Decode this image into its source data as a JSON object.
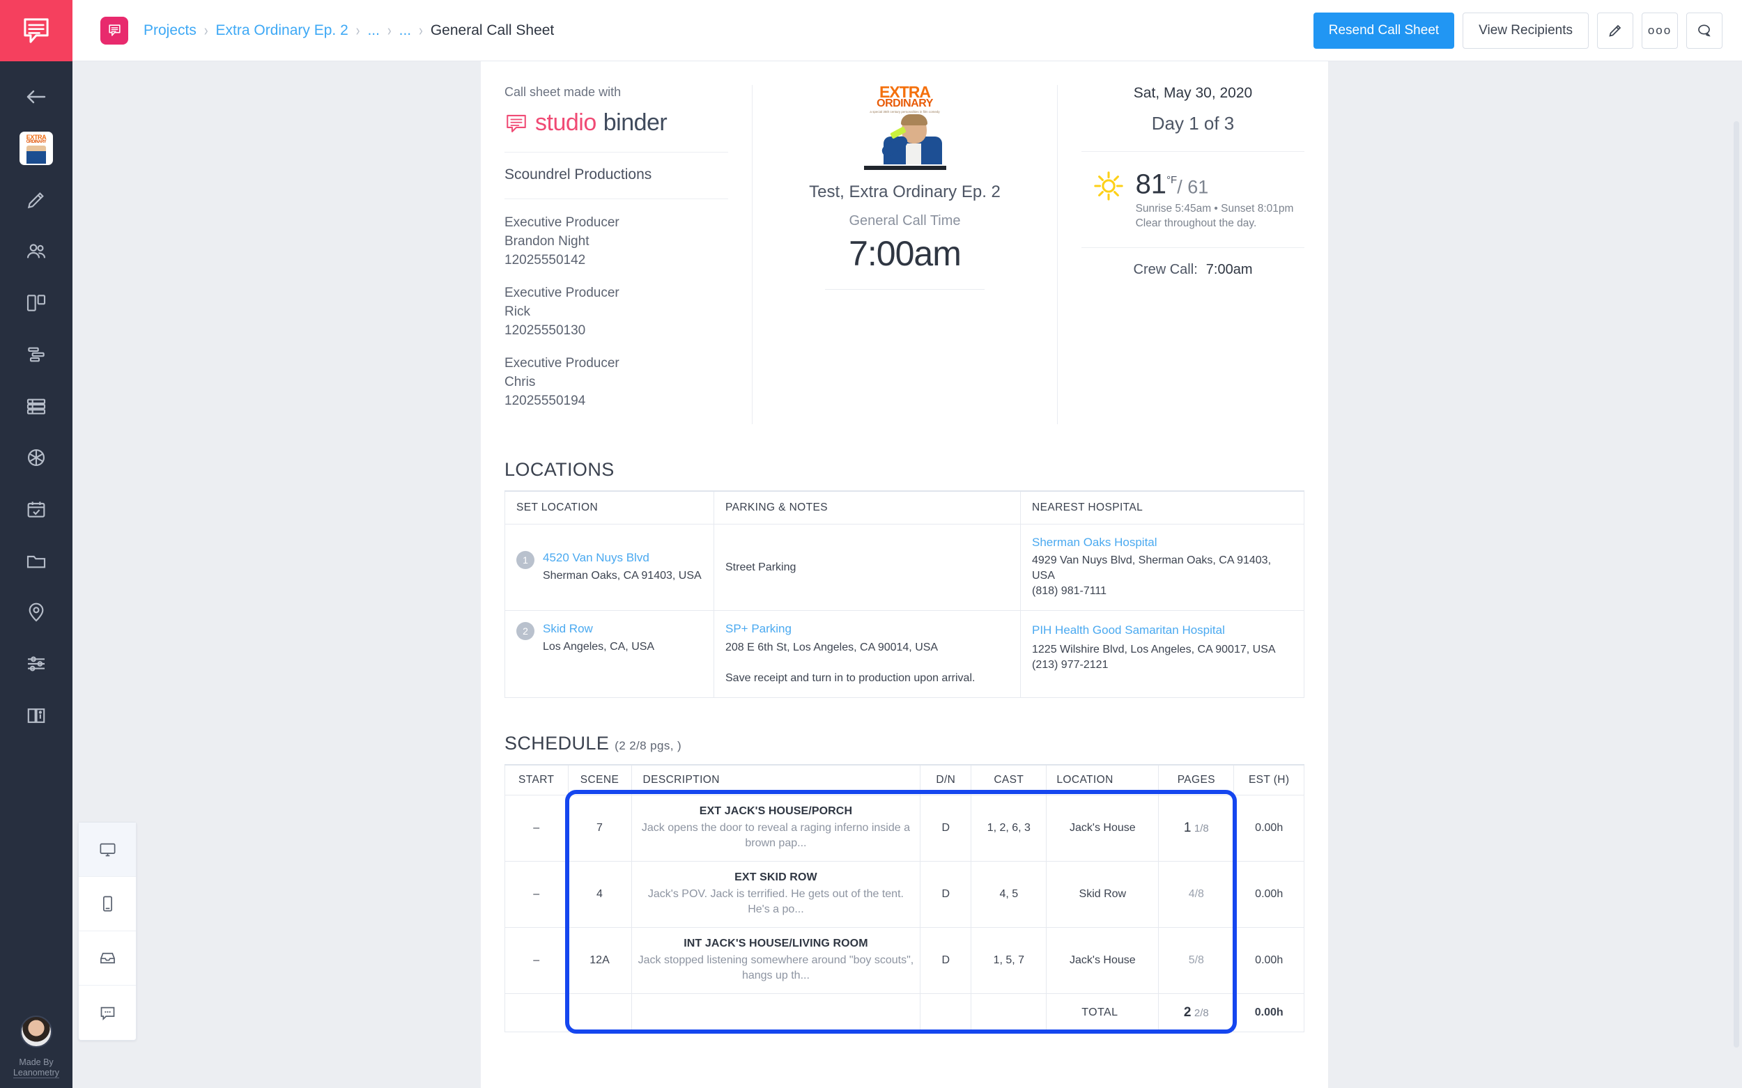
{
  "app": {
    "logo_icon": "studiobinder-speech-bubble-icon"
  },
  "topbar": {
    "breadcrumb": [
      {
        "label": "Projects",
        "current": false
      },
      {
        "label": "Extra Ordinary Ep. 2",
        "current": false
      },
      {
        "label": "...",
        "current": false
      },
      {
        "label": "...",
        "current": false
      },
      {
        "label": "General Call Sheet",
        "current": true
      }
    ],
    "separator": "›",
    "resend_label": "Resend Call Sheet",
    "view_recipients_label": "View Recipients",
    "edit_icon": "pencil-icon",
    "more_icon": "more-options-icon",
    "more_glyph": "ooo",
    "comments_icon": "comment-bubble-icon",
    "accent_primary": "#2196f3",
    "brand_pink": "#e82a6d"
  },
  "sidebar": {
    "back_icon": "back-arrow-icon",
    "project_thumb_name": "extra-ordinary-project-thumbnail",
    "items": [
      {
        "icon": "pencil-icon",
        "name": "sidebar-item-write"
      },
      {
        "icon": "people-icon",
        "name": "sidebar-item-contacts"
      },
      {
        "icon": "columns-icon",
        "name": "sidebar-item-boards"
      },
      {
        "icon": "gantt-icon",
        "name": "sidebar-item-schedule"
      },
      {
        "icon": "rows-icon",
        "name": "sidebar-item-shotlist"
      },
      {
        "icon": "aperture-icon",
        "name": "sidebar-item-storyboard"
      },
      {
        "icon": "calendar-check-icon",
        "name": "sidebar-item-calendar"
      },
      {
        "icon": "folder-icon",
        "name": "sidebar-item-files"
      },
      {
        "icon": "map-pin-icon",
        "name": "sidebar-item-locations"
      },
      {
        "icon": "sliders-icon",
        "name": "sidebar-item-settings"
      },
      {
        "icon": "book-info-icon",
        "name": "sidebar-item-guide"
      }
    ],
    "footer": {
      "avatar_name": "user-avatar",
      "made_by_prefix": "Made By",
      "made_by_name": "Leanometry"
    }
  },
  "device_panel": {
    "buttons": [
      {
        "icon": "desktop-icon",
        "name": "preview-desktop-button",
        "active": true
      },
      {
        "icon": "mobile-icon",
        "name": "preview-mobile-button",
        "active": false
      },
      {
        "icon": "inbox-icon",
        "name": "preview-email-button",
        "active": false
      },
      {
        "icon": "chat-icon",
        "name": "preview-sms-button",
        "active": false
      }
    ]
  },
  "callsheet": {
    "left": {
      "made_with": "Call sheet made with",
      "brand_word1": "studio",
      "brand_word2": "binder",
      "production_company": "Scoundrel Productions",
      "crew": [
        {
          "role": "Executive Producer",
          "name": "Brandon Night",
          "phone": "12025550142"
        },
        {
          "role": "Executive Producer",
          "name": "Rick",
          "phone": "12025550130"
        },
        {
          "role": "Executive Producer",
          "name": "Chris",
          "phone": "12025550194"
        }
      ]
    },
    "middle": {
      "poster_title": "EXTRA",
      "poster_title2": "ORDINARY",
      "poster_tagline": "a special 35th century personalities in film comedy",
      "project_title": "Test, Extra Ordinary Ep. 2",
      "call_time_label": "General Call Time",
      "call_time": "7:00am"
    },
    "right": {
      "date": "Sat, May 30, 2020",
      "day_of": "Day 1 of 3",
      "weather_icon": "sun-icon",
      "temp_high": "81",
      "temp_unit": "°F",
      "temp_low": "/ 61",
      "sun_times": "Sunrise 5:45am • Sunset 8:01pm",
      "conditions": "Clear throughout the day.",
      "crew_call_label": "Crew Call:",
      "crew_call_time": "7:00am"
    },
    "locations": {
      "title": "LOCATIONS",
      "headers": [
        "SET LOCATION",
        "PARKING & NOTES",
        "NEAREST HOSPITAL"
      ],
      "rows": [
        {
          "num": "1",
          "set_name": "4520 Van Nuys Blvd",
          "set_addr": "Sherman Oaks, CA 91403, USA",
          "parking_name": "",
          "parking_addr": "Street Parking",
          "parking_note": "",
          "hospital_name": "Sherman Oaks Hospital",
          "hospital_addr": "4929 Van Nuys Blvd, Sherman Oaks, CA 91403, USA",
          "hospital_phone": "(818) 981-7111"
        },
        {
          "num": "2",
          "set_name": "Skid Row",
          "set_addr": "Los Angeles, CA, USA",
          "parking_name": "SP+ Parking",
          "parking_addr": "208 E 6th St, Los Angeles, CA 90014, USA",
          "parking_note": "Save receipt and turn in to production upon arrival.",
          "hospital_name": "PIH Health Good Samaritan Hospital",
          "hospital_addr": "1225 Wilshire Blvd, Los Angeles, CA 90017, USA",
          "hospital_phone": "(213) 977-2121"
        }
      ]
    },
    "schedule": {
      "title": "SCHEDULE",
      "subtitle": "(2 2/8 pgs, )",
      "headers": [
        "START",
        "SCENE",
        "DESCRIPTION",
        "D/N",
        "CAST",
        "LOCATION",
        "PAGES",
        "EST (H)"
      ],
      "rows": [
        {
          "start": "–",
          "scene": "7",
          "title": "EXT JACK'S HOUSE/PORCH",
          "synopsis": "Jack opens the door to reveal a raging inferno inside a brown pap...",
          "dn": "D",
          "cast": "1, 2, 6, 3",
          "location": "Jack's House",
          "pages_whole": "1",
          "pages_frac": "1/8",
          "est": "0.00h"
        },
        {
          "start": "–",
          "scene": "4",
          "title": "EXT SKID ROW",
          "synopsis": "Jack's POV. Jack is terrified. He gets out of the tent. He's a po...",
          "dn": "D",
          "cast": "4, 5",
          "location": "Skid Row",
          "pages_whole": "",
          "pages_frac": "4/8",
          "est": "0.00h"
        },
        {
          "start": "–",
          "scene": "12A",
          "title": "INT JACK'S HOUSE/LIVING ROOM",
          "synopsis": "Jack stopped listening somewhere around \"boy scouts\", hangs up th...",
          "dn": "D",
          "cast": "1, 5, 7",
          "location": "Jack's House",
          "pages_whole": "",
          "pages_frac": "5/8",
          "est": "0.00h"
        }
      ],
      "total_label": "TOTAL",
      "total_pages_whole": "2",
      "total_pages_frac": "2/8",
      "total_est": "0.00h",
      "highlight_color": "#1546ef"
    }
  }
}
